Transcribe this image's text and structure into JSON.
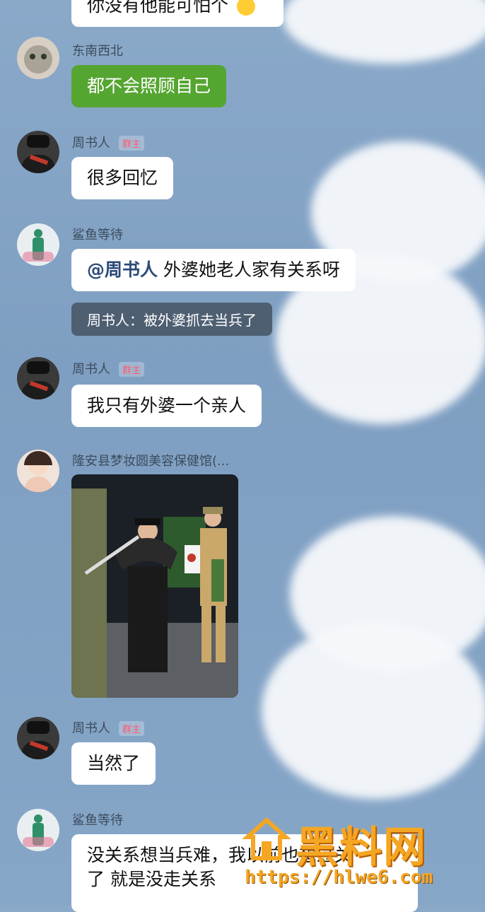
{
  "messages": [
    {
      "id": "m0",
      "sender": "",
      "text": "你没有他能可怕个"
    },
    {
      "id": "m1",
      "sender": "东南西北",
      "text": "都不会照顾自己",
      "style": "green"
    },
    {
      "id": "m2",
      "sender": "周书人",
      "badge": "群主",
      "text": "很多回忆"
    },
    {
      "id": "m3",
      "sender": "鲨鱼等待",
      "mention": "@周书人",
      "text": " 外婆她老人家有关系呀",
      "quote": "周书人：被外婆抓去当兵了"
    },
    {
      "id": "m4",
      "sender": "周书人",
      "badge": "群主",
      "text": "我只有外婆一个亲人"
    },
    {
      "id": "m5",
      "sender": "隆安县梦妆圆美容保健馆(...",
      "type": "image"
    },
    {
      "id": "m6",
      "sender": "周书人",
      "badge": "群主",
      "text": "当然了"
    },
    {
      "id": "m7",
      "sender": "鲨鱼等待",
      "text_line1": "没关系想当兵难，我以前也想过关",
      "text_line2": "了 就是没走关系"
    }
  ],
  "watermark": {
    "title": "黑料网",
    "url": "https://hlwe6.com"
  },
  "colors": {
    "green_bubble": "#55a531",
    "badge": "#ff5a6e",
    "watermark": "#f5a623"
  }
}
